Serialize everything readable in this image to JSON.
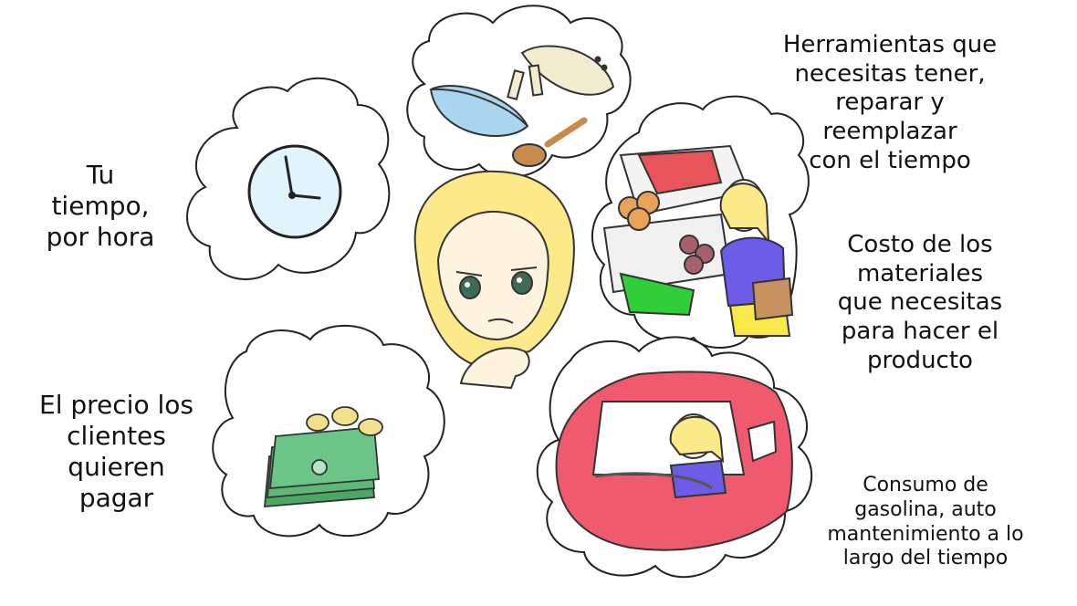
{
  "labels": {
    "tools": "Herramientas que\nnecesitas tener,\nreparar y reemplazar\ncon el tiempo",
    "time": "Tu\ntiempo,\npor hora",
    "materials": "Costo de los\nmateriales\nque necesitas\npara hacer el\nproducto",
    "price": "El precio los\nclientes\nquieren\npagar",
    "gas": "Consumo de\ngasolina, auto\nmantenimiento a lo\nlargo del tiempo"
  },
  "icons": {
    "clock": "clock-icon",
    "money": "money-icon",
    "tools": "kitchen-tools-icon",
    "shopping": "grocery-shopping-icon",
    "car": "car-icon",
    "girl": "thinking-girl-icon"
  },
  "colors": {
    "hair": "#fbe98a",
    "skin": "#fdf3de",
    "shirt": "#6c5ce7",
    "car": "#ef5a6f",
    "money": "#5fb87a",
    "coin": "#f3e08a",
    "clock_face": "#e1f3fb",
    "bowl": "#a9d6ee",
    "spoon": "#c88b4d"
  }
}
